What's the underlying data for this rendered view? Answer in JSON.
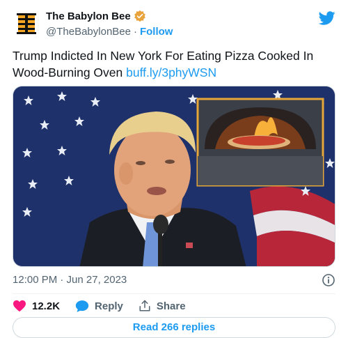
{
  "author": {
    "display_name": "The Babylon Bee",
    "handle": "@TheBabylonBee",
    "separator": "·",
    "follow_label": "Follow"
  },
  "tweet": {
    "text": "Trump Indicted In New York For Eating Pizza Cooked In Wood-Burning Oven ",
    "link_text": "buff.ly/3phyWSN"
  },
  "meta": {
    "timestamp": "12:00 PM · Jun 27, 2023"
  },
  "actions": {
    "like_count": "12.2K",
    "reply_label": "Reply",
    "share_label": "Share"
  },
  "read_replies_label": "Read 266 replies",
  "colors": {
    "accent": "#1d9bf0",
    "like": "#f91880",
    "secondary_text": "#536471",
    "verified_badge": "#e8a33c",
    "bee_logo": "#f5a623"
  },
  "icons": {
    "avatar": "babylon-bee-logo",
    "verified": "verified-badge-icon",
    "brand": "twitter-bird-icon",
    "info": "info-icon",
    "like": "heart-icon",
    "reply": "speech-bubble-icon",
    "share": "share-upload-icon"
  }
}
